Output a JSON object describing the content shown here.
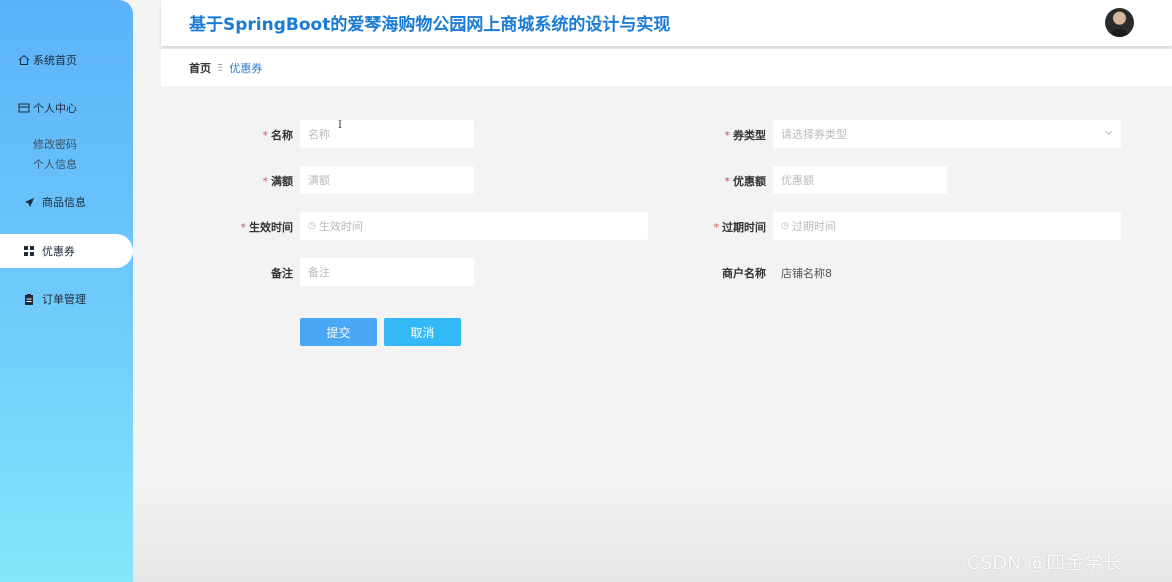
{
  "header": {
    "title": "基于SpringBoot的爱琴海购物公园网上商城系统的设计与实现"
  },
  "sidebar": {
    "items": [
      {
        "label": "系统首页",
        "icon": "home-icon"
      },
      {
        "label": "个人中心",
        "icon": "card-icon"
      },
      {
        "label": "商品信息",
        "icon": "paper-plane-icon"
      },
      {
        "label": "优惠券",
        "icon": "grid-icon"
      },
      {
        "label": "订单管理",
        "icon": "clipboard-icon"
      }
    ],
    "subitems": [
      "修改密码",
      "个人信息"
    ],
    "active": "优惠券"
  },
  "breadcrumb": {
    "home": "首页",
    "separator": "Ξ",
    "current": "优惠券"
  },
  "form": {
    "name": {
      "label": "名称",
      "placeholder": "名称"
    },
    "coupon_type": {
      "label": "券类型",
      "placeholder": "请选择券类型"
    },
    "threshold": {
      "label": "满额",
      "placeholder": "满额"
    },
    "discount": {
      "label": "优惠额",
      "placeholder": "优惠额"
    },
    "start_time": {
      "label": "生效时间",
      "placeholder": "生效时间"
    },
    "end_time": {
      "label": "过期时间",
      "placeholder": "过期时间"
    },
    "note": {
      "label": "备注",
      "placeholder": "备注"
    },
    "merchant": {
      "label": "商户名称",
      "value": "店铺名称8"
    },
    "required_mark": "*"
  },
  "buttons": {
    "submit": "提交",
    "cancel": "取消"
  },
  "watermark": "CSDN @四金学长",
  "colors": {
    "accent": "#1a7bd6",
    "sidebar_top": "#5cb2f8",
    "sidebar_bottom": "#86e6fa",
    "required": "#e94b4b"
  }
}
